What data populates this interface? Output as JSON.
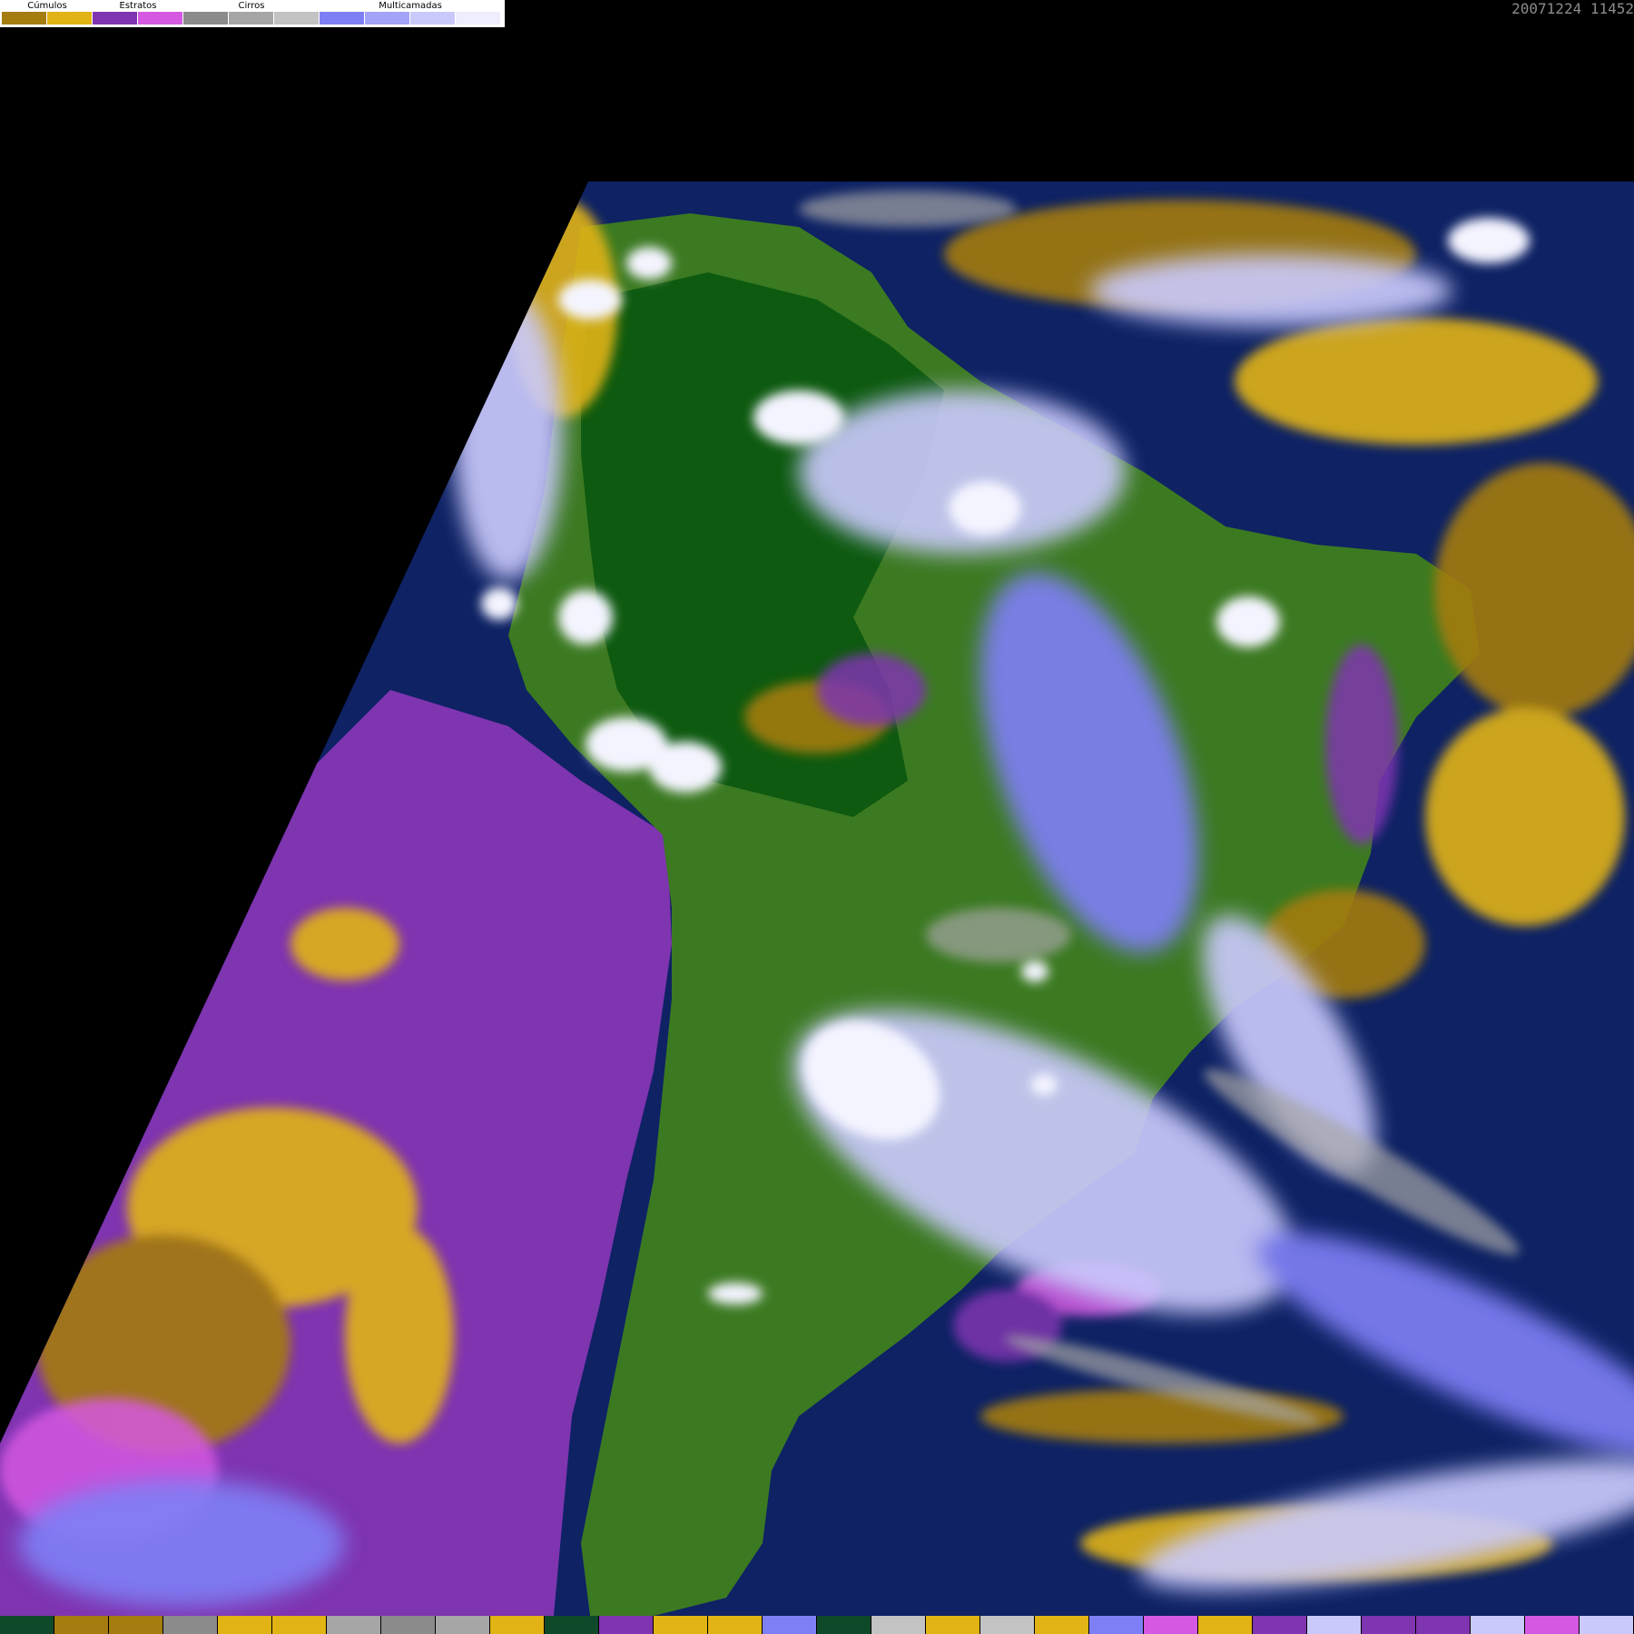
{
  "image": {
    "type": "satellite-cloud-classification",
    "timestamp": "20071224  11452"
  },
  "legend": {
    "groups": [
      {
        "label": "Cúmulos",
        "colors": [
          "#a47c10",
          "#e1b315"
        ]
      },
      {
        "label": "Estratos",
        "colors": [
          "#7f34b0",
          "#d558e2"
        ]
      },
      {
        "label": "Cirros",
        "colors": [
          "#8b8b8b",
          "#a6a6a6",
          "#c3c3c3"
        ]
      },
      {
        "label": "Multicamadas",
        "colors": [
          "#7f7ff5",
          "#a3a3f7",
          "#c9c9fb",
          "#eeeeff"
        ]
      }
    ]
  },
  "colors": {
    "background": "#000000",
    "ocean": "#0e2264",
    "land_forest": "#0e5a10",
    "land": "#3c7a22",
    "stratus": "#7f34b0",
    "stratus_light": "#d558e2",
    "cumulus": "#a47c10",
    "cumulus_light": "#e1b315",
    "cirrus": "#a6a6a6",
    "multilayer": "#7f7ff5",
    "multilayer_light": "#c9c9fb",
    "white_cloud": "#f4f4ff"
  },
  "bottom_strip": [
    "#0e4a2a",
    "#a47c10",
    "#a47c10",
    "#8b8b8b",
    "#e1b315",
    "#e1b315",
    "#a6a6a6",
    "#8b8b8b",
    "#a6a6a6",
    "#e1b315",
    "#0e4a2a",
    "#7f34b0",
    "#e1b315",
    "#e1b315",
    "#7f7ff5",
    "#0e4a2a",
    "#c3c3c3",
    "#e1b315",
    "#c3c3c3",
    "#e1b315",
    "#7f7ff5",
    "#d558e2",
    "#e1b315",
    "#7f34b0",
    "#c9c9fb",
    "#7f34b0",
    "#7f34b0",
    "#c9c9fb",
    "#d558e2",
    "#c9c9fb"
  ]
}
